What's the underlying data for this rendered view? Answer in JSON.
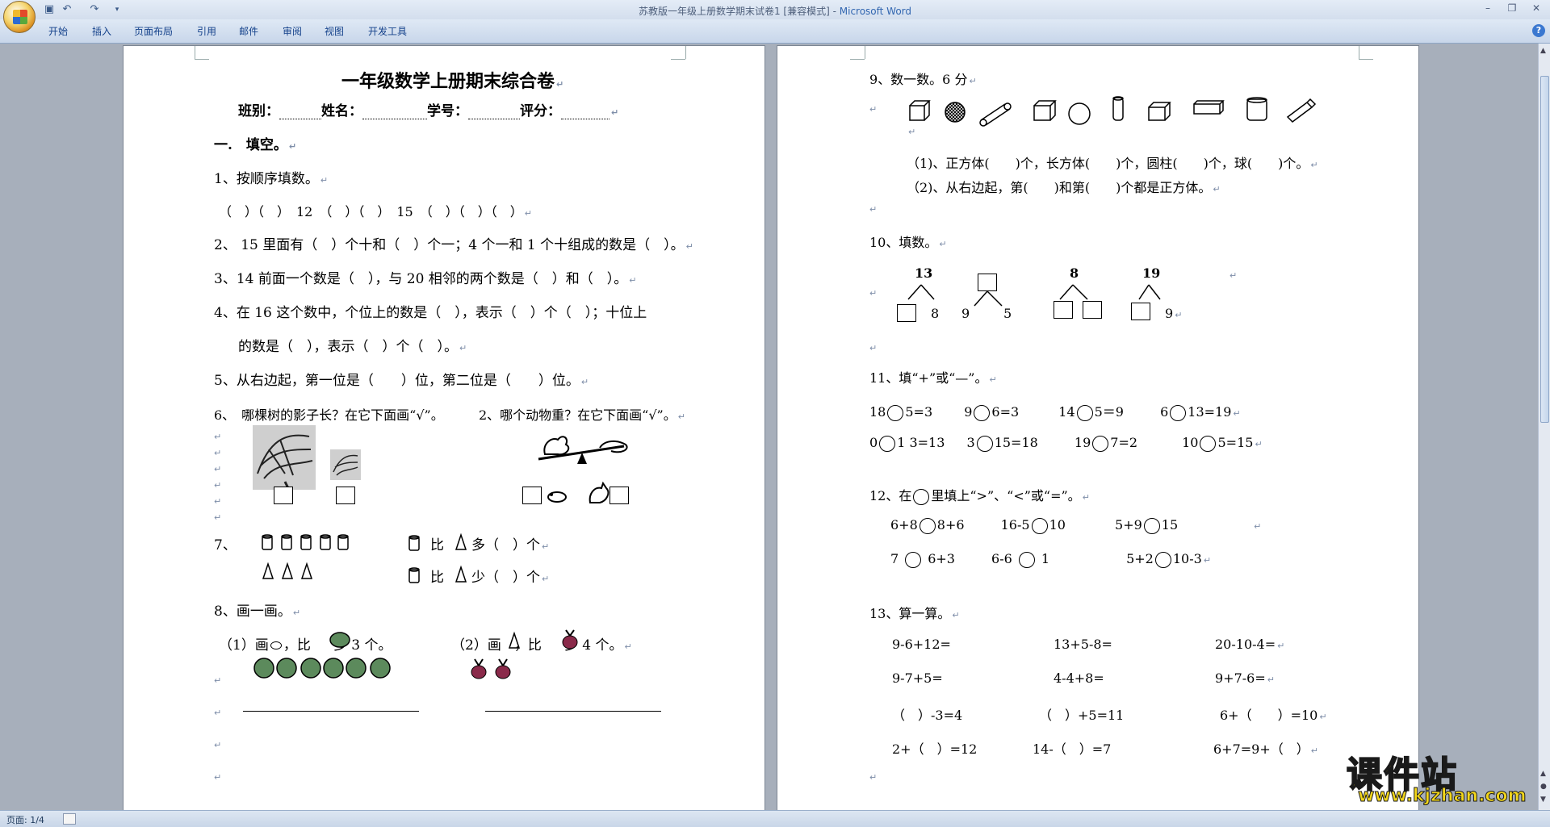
{
  "window": {
    "title_prefix": "苏教版一年级上册数学期末试卷1 [兼容模式] -",
    "app_name": "Microsoft Word"
  },
  "ribbon": {
    "tabs": [
      "开始",
      "插入",
      "页面布局",
      "引用",
      "邮件",
      "审阅",
      "视图",
      "开发工具"
    ]
  },
  "statusbar": {
    "page": "页面: 1/4"
  },
  "watermark": {
    "name": "课件站",
    "url": "www.kjzhan.com"
  },
  "page1": {
    "title": "一年级数学上册期末综合卷",
    "labels": {
      "class": "班别：",
      "name": "姓名：",
      "id": "学号：",
      "score": "评分："
    },
    "section1": "一.　填空。",
    "q1": "1、按顺序填数。",
    "q1_seq": "（　）（　）　12　（　）（　）　15　（　）（　）（　）",
    "q2": "2、 15 里面有（　）个十和（　）个一；4 个一和 1 个十组成的数是（　）。",
    "q3": "3、14 前面一个数是（　），与 20 相邻的两个数是（　）和（　）。",
    "q4a": "4、在 16 这个数中，个位上的数是（　），表示（　）个（　）；十位上",
    "q4b": "的数是（　），表示（　）个（　）。",
    "q5": "5、从右边起，第一位是（　　）位，第二位是（　　）位。",
    "q6a": "6、　哪棵树的影子长？在它下面画“√”。",
    "q6b": "2、哪个动物重？在它下面画“√”。",
    "q7": "7、",
    "q7_more": "比　　多（　）个",
    "q7_less": "比　　少（　）个",
    "q8": "8、画一画。",
    "q8a_1": "（1）画",
    "q8a_2": "，比",
    "q8a_3": "多 3 个。",
    "q8b_1": "（2）画",
    "q8b_2": "，比",
    "q8b_3": "多 4 个。"
  },
  "page2": {
    "q9": "9、数一数。6 分",
    "q9_1": "（1)、正方体(　　)个，长方体(　　)个，圆柱(　　)个，球(　　)个。",
    "q9_2": "（2)、从右边起，第(　　)和第(　　)个都是正方体。",
    "q10": "10、填数。",
    "q10_nums": {
      "a_top": "13",
      "a_right": "8",
      "b_left": "9",
      "b_right": "5",
      "c_top": "8",
      "d_top": "19",
      "d_right": "9"
    },
    "q11": "11、填“+”或“—”。",
    "q11_row1": [
      "18",
      "5=3",
      "9",
      "6=3",
      "14",
      "5＝9",
      "6",
      "13=19"
    ],
    "q11_row2": [
      "0",
      "1 3=13",
      "3",
      "15=18",
      "19",
      "7=2",
      "10",
      "5=15"
    ],
    "q12": "12、在",
    "q12_rest": "里填上“>”、“<”或“=”。",
    "q12_row1": [
      "6+8",
      "8+6",
      "16-5",
      "10",
      "5+9",
      "15"
    ],
    "q12_row2": [
      "7",
      "6+3",
      "6-6",
      "1",
      "5+2",
      "10-3"
    ],
    "q13": "13、算一算。",
    "q13_rows": [
      [
        "9-6+12=",
        "13+5-8=",
        "20-10-4="
      ],
      [
        "9-7+5=",
        "4-4+8=",
        "9+7-6="
      ],
      [
        "（　）-3=4",
        "（　）+5=11",
        "6+（　　）=10"
      ],
      [
        "2+（　）=12",
        "14-（　）=7",
        "6+7=9+（　）"
      ]
    ]
  }
}
